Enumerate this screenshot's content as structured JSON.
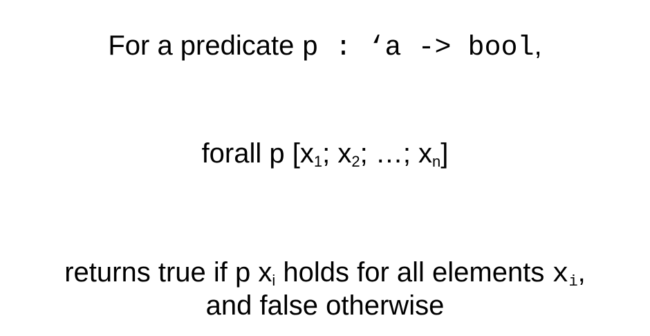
{
  "line1": {
    "prefix": "For a predicate ",
    "code": "p : ‘a -> bool",
    "suffix": ","
  },
  "line2": {
    "lead": "forall p [x",
    "sub1": "1",
    "sep1": "; x",
    "sub2": "2",
    "sep2": "; …; x",
    "subn": "n",
    "close": "]"
  },
  "line3": {
    "lead": "returns true if p x",
    "sub_i": "i",
    "middle": " holds for all elements ",
    "code_x": "x",
    "code_sub_i": "i",
    "comma": ","
  },
  "line4": {
    "text": "and false otherwise"
  }
}
